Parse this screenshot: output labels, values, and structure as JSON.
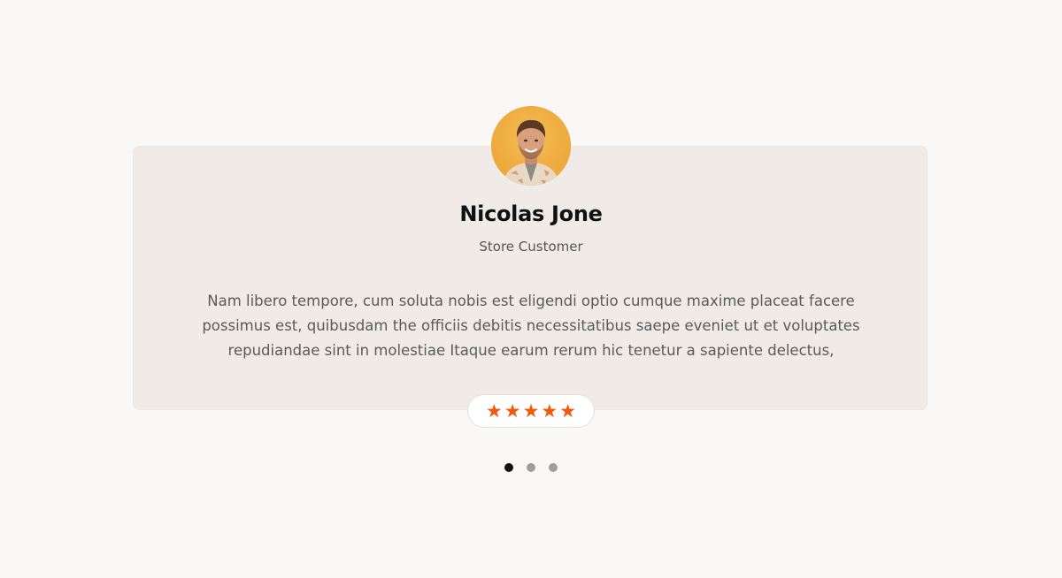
{
  "testimonial": {
    "name": "Nicolas Jone",
    "role": "Store Customer",
    "quote": "Nam libero tempore, cum soluta nobis est eligendi optio cumque maxime placeat facere possimus est, quibusdam the officiis debitis necessitatibus saepe eveniet ut et voluptates repudiandae sint in molestiae Itaque earum rerum hic tenetur a sapiente delectus,",
    "avatar_icon": "avatar-photo",
    "rating": {
      "value": 5,
      "max": 5,
      "star_glyph": "★",
      "star_color": "#f05a0a"
    }
  },
  "pagination": {
    "total": 3,
    "active_index": 0
  },
  "colors": {
    "page_bg": "#f9f8f6",
    "card_bg": "#f0ebe6",
    "avatar_bg": "#f0a93a",
    "dot_active": "#111111",
    "dot_inactive": "#9e9e9e"
  }
}
